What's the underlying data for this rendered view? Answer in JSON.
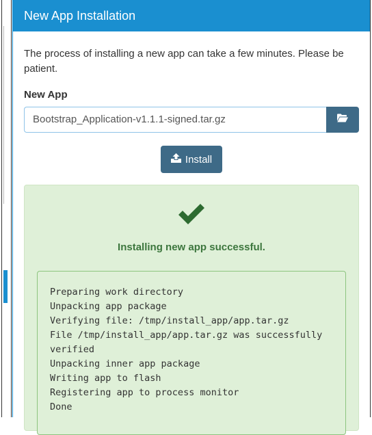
{
  "panel": {
    "title": "New App Installation",
    "intro": "The process of installing a new app can take a few minutes. Please be patient.",
    "field_label": "New App",
    "file_value": "Bootstrap_Application-v1.1.1-signed.tar.gz",
    "browse_icon": "folder-open-icon",
    "install_label": "Install",
    "install_icon": "upload-icon"
  },
  "result": {
    "status_icon": "check-icon",
    "message": "Installing new app successful.",
    "log": [
      "Preparing work directory",
      "Unpacking app package",
      "Verifying file: /tmp/install_app/app.tar.gz",
      "File /tmp/install_app/app.tar.gz was successfully",
      "verified",
      "Unpacking inner app package",
      "Writing app to flash",
      "Registering app to process monitor",
      "Done"
    ]
  },
  "colors": {
    "header": "#1a8fd0",
    "button": "#3e6a87",
    "success_bg": "#dff0d8",
    "success_text": "#3c763d",
    "check": "#2d6b30"
  }
}
